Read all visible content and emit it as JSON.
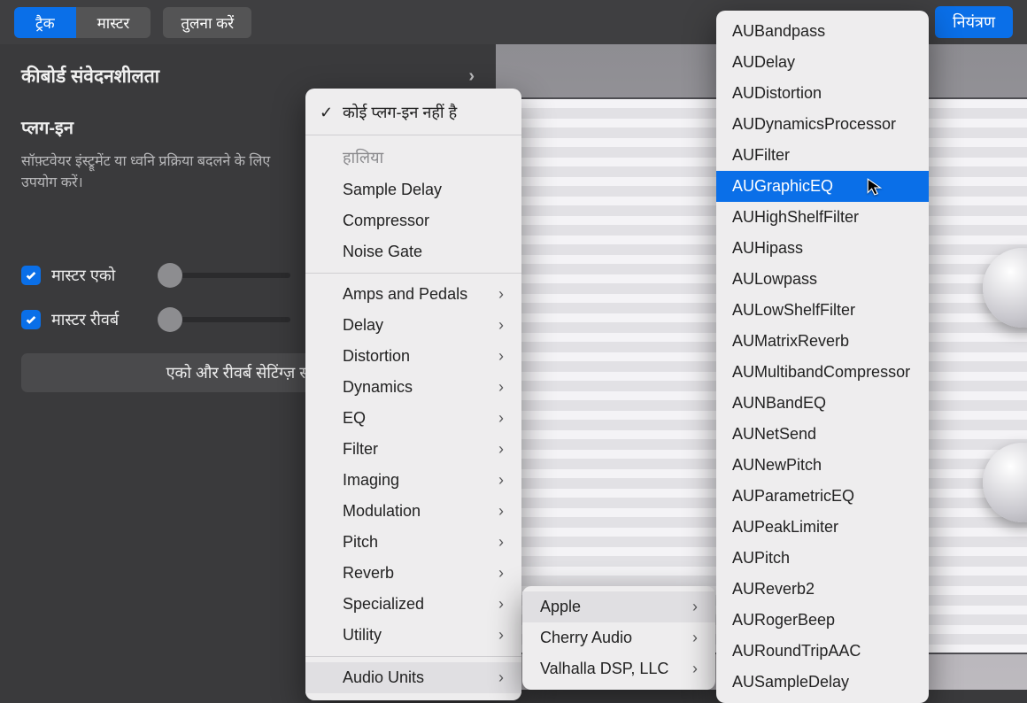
{
  "toolbar": {
    "tab_track": "ट्रैक",
    "tab_master": "मास्टर",
    "compare": "तुलना करें",
    "control": "नियंत्रण"
  },
  "left": {
    "keyboard_sensitivity": "कीबोर्ड संवेदनशीलता",
    "plugins_title": "प्लग-इन",
    "plugins_hint": "सॉफ़्टवेयर इंस्ट्रूमेंट या ध्वनि प्रक्रिया बदलने के लिए उपयोग करें।",
    "master_echo": "मास्टर एको",
    "master_reverb": "मास्टर रीवर्ब",
    "echo_reverb_btn": "एको और रीवर्ब सेटिंग्ज़ स"
  },
  "menu1": {
    "no_plugin": "कोई प्लग-इन नहीं है",
    "recent_header": "हालिया",
    "recent": [
      "Sample Delay",
      "Compressor",
      "Noise Gate"
    ],
    "categories": [
      "Amps and Pedals",
      "Delay",
      "Distortion",
      "Dynamics",
      "EQ",
      "Filter",
      "Imaging",
      "Modulation",
      "Pitch",
      "Reverb",
      "Specialized",
      "Utility"
    ],
    "audio_units": "Audio Units"
  },
  "menu2": {
    "items": [
      "Apple",
      "Cherry Audio",
      "Valhalla DSP, LLC"
    ]
  },
  "menu3": {
    "items": [
      "AUBandpass",
      "AUDelay",
      "AUDistortion",
      "AUDynamicsProcessor",
      "AUFilter",
      "AUGraphicEQ",
      "AUHighShelfFilter",
      "AUHipass",
      "AULowpass",
      "AULowShelfFilter",
      "AUMatrixReverb",
      "AUMultibandCompressor",
      "AUNBandEQ",
      "AUNetSend",
      "AUNewPitch",
      "AUParametricEQ",
      "AUPeakLimiter",
      "AUPitch",
      "AUReverb2",
      "AURogerBeep",
      "AURoundTripAAC",
      "AUSampleDelay"
    ],
    "selected_index": 5
  }
}
